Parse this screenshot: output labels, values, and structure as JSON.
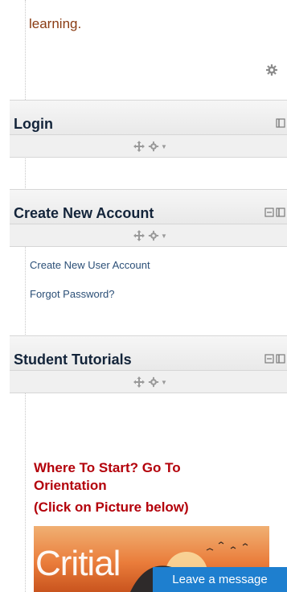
{
  "intro": {
    "text_clipped": "learning",
    "text": "learning."
  },
  "blocks": [
    {
      "title": "Login"
    },
    {
      "title": "Create New Account"
    },
    {
      "title": "Student Tutorials"
    }
  ],
  "create_account_links": [
    {
      "label": "Create New User Account"
    },
    {
      "label": "Forgot Password?"
    }
  ],
  "tutorials": {
    "heading_line1": "Where To Start? Go To",
    "heading_line2": "Orientation",
    "subheading": "(Click on Picture below)",
    "picture_text": "Critial"
  },
  "chat": {
    "label": "Leave a message"
  },
  "colors": {
    "accent_red": "#b3000a",
    "link_blue": "#2b4f77",
    "chat_blue": "#1e7fcf"
  }
}
